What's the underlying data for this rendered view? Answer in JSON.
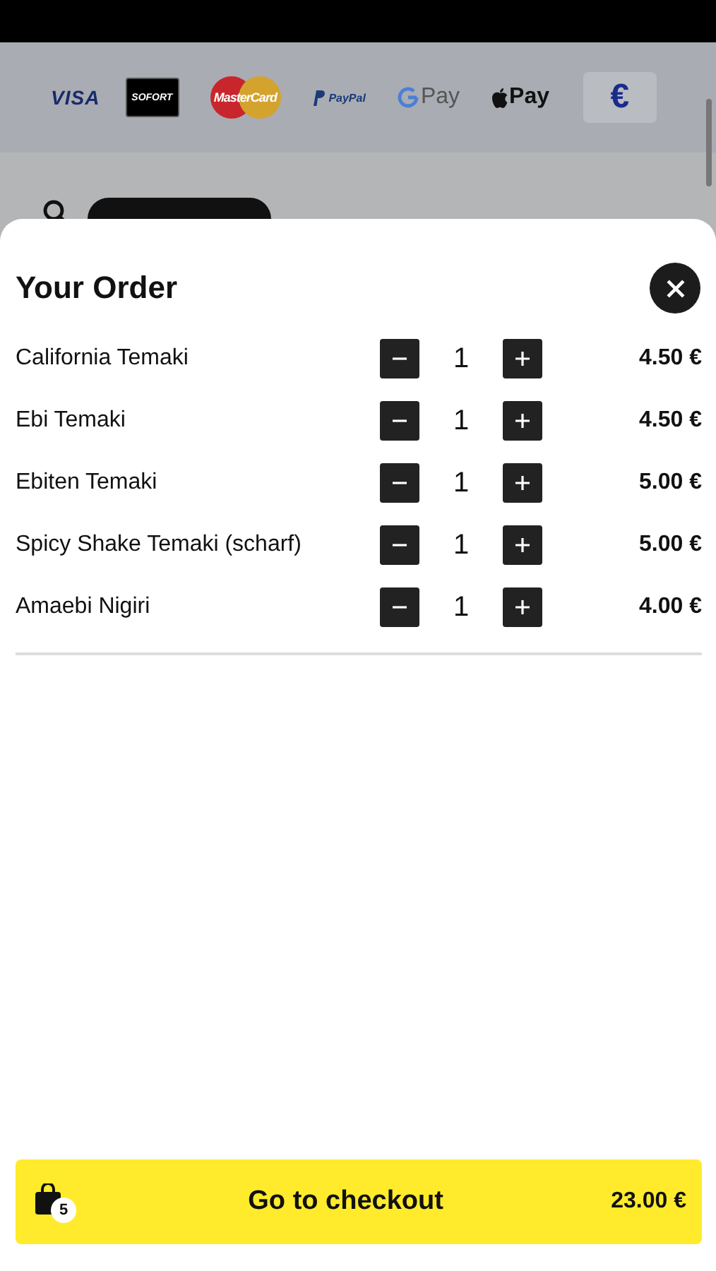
{
  "payment_methods": [
    {
      "kind": "visa",
      "label": "VISA"
    },
    {
      "kind": "sofort",
      "label": "SOFORT"
    },
    {
      "kind": "mastercard",
      "label": "MasterCard"
    },
    {
      "kind": "paypal",
      "label": "PayPal"
    },
    {
      "kind": "gpay",
      "label": "Pay"
    },
    {
      "kind": "applepay",
      "label": "Pay"
    }
  ],
  "currency_button": "€",
  "order": {
    "title": "Your Order",
    "items": [
      {
        "name": "California Temaki",
        "quantity": "1",
        "price": "4.50 €"
      },
      {
        "name": "Ebi Temaki",
        "quantity": "1",
        "price": "4.50 €"
      },
      {
        "name": "Ebiten Temaki",
        "quantity": "1",
        "price": "5.00 €"
      },
      {
        "name": "Spicy Shake Temaki (scharf)",
        "quantity": "1",
        "price": "5.00 €"
      },
      {
        "name": "Amaebi Nigiri",
        "quantity": "1",
        "price": "4.00 €"
      }
    ]
  },
  "checkout": {
    "label": "Go to checkout",
    "count": "5",
    "total": "23.00 €"
  }
}
